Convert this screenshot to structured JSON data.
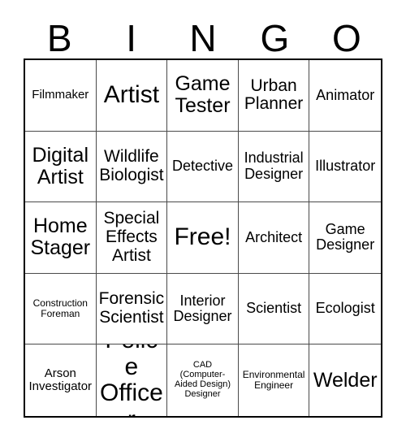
{
  "card": {
    "header_letters": [
      "B",
      "I",
      "N",
      "G",
      "O"
    ],
    "free_space_label": "Free!",
    "grid": [
      [
        {
          "text": "Filmmaker",
          "size": "sm"
        },
        {
          "text": "Artist",
          "size": "xxl"
        },
        {
          "text": "Game Tester",
          "size": "xl"
        },
        {
          "text": "Urban Planner",
          "size": "lg"
        },
        {
          "text": "Animator",
          "size": "md"
        }
      ],
      [
        {
          "text": "Digital Artist",
          "size": "xl"
        },
        {
          "text": "Wildlife Biologist",
          "size": "lg"
        },
        {
          "text": "Detective",
          "size": "md"
        },
        {
          "text": "Industrial Designer",
          "size": "md"
        },
        {
          "text": "Illustrator",
          "size": "md"
        }
      ],
      [
        {
          "text": "Home Stager",
          "size": "xl"
        },
        {
          "text": "Special Effects Artist",
          "size": "lg"
        },
        {
          "text": "Free!",
          "size": "xxl"
        },
        {
          "text": "Architect",
          "size": "md"
        },
        {
          "text": "Game Designer",
          "size": "md"
        }
      ],
      [
        {
          "text": "Construction Foreman",
          "size": "xs"
        },
        {
          "text": "Forensic Scientist",
          "size": "lg"
        },
        {
          "text": "Interior Designer",
          "size": "md"
        },
        {
          "text": "Scientist",
          "size": "md"
        },
        {
          "text": "Ecologist",
          "size": "md"
        }
      ],
      [
        {
          "text": "Arson Investigator",
          "size": "sm"
        },
        {
          "text": "Police Officer",
          "size": "xxl"
        },
        {
          "text": "CAD (Computer-Aided Design) Designer",
          "size": "xxs"
        },
        {
          "text": "Environmental Engineer",
          "size": "xs"
        },
        {
          "text": "Welder",
          "size": "xl"
        }
      ]
    ]
  },
  "colors": {
    "background": "#ffffff",
    "text": "#000000",
    "outer_border": "#000000",
    "inner_border": "#4a4a4a"
  }
}
